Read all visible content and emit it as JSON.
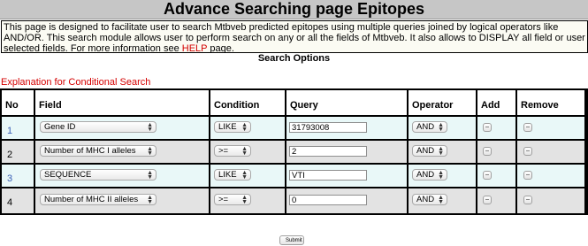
{
  "page_title": "Advance Searching page Epitopes",
  "info": {
    "text_before_link": "This page is designed to facilitate user to search Mtbveb predicted epitopes using multiple queries joined by logical operators like AND/OR. This search module allows user to perform search on any or all the fields of Mtbveb. It also allows to DISPLAY all field or user selected fields. For more information see ",
    "help_link": "HELP",
    "text_after_link": " page."
  },
  "search_options_label": "Search Options",
  "explanation_link": "Explanation for Conditional Search",
  "table": {
    "headers": [
      "No",
      "Field",
      "Condition",
      "Query",
      "Operator",
      "Add",
      "Remove"
    ],
    "rows": [
      {
        "no": "1",
        "field": "Gene ID",
        "condition": "LIKE",
        "query": "31793008",
        "operator": "AND"
      },
      {
        "no": "2",
        "field": "Number of MHC I alleles",
        "condition": ">=",
        "query": "2",
        "operator": "AND"
      },
      {
        "no": "3",
        "field": "SEQUENCE",
        "condition": "LIKE",
        "query": "VTI",
        "operator": "AND"
      },
      {
        "no": "4",
        "field": "Number of MHC II alleles",
        "condition": ">=",
        "query": "0",
        "operator": "AND"
      }
    ]
  },
  "submit_label": "Submit",
  "colors": {
    "title_bar": "#c6c6c6",
    "row_odd": "#e9f8f8",
    "row_even": "#e3e3e3",
    "link_red": "#d40000",
    "link_blue": "#3a5fb5"
  }
}
